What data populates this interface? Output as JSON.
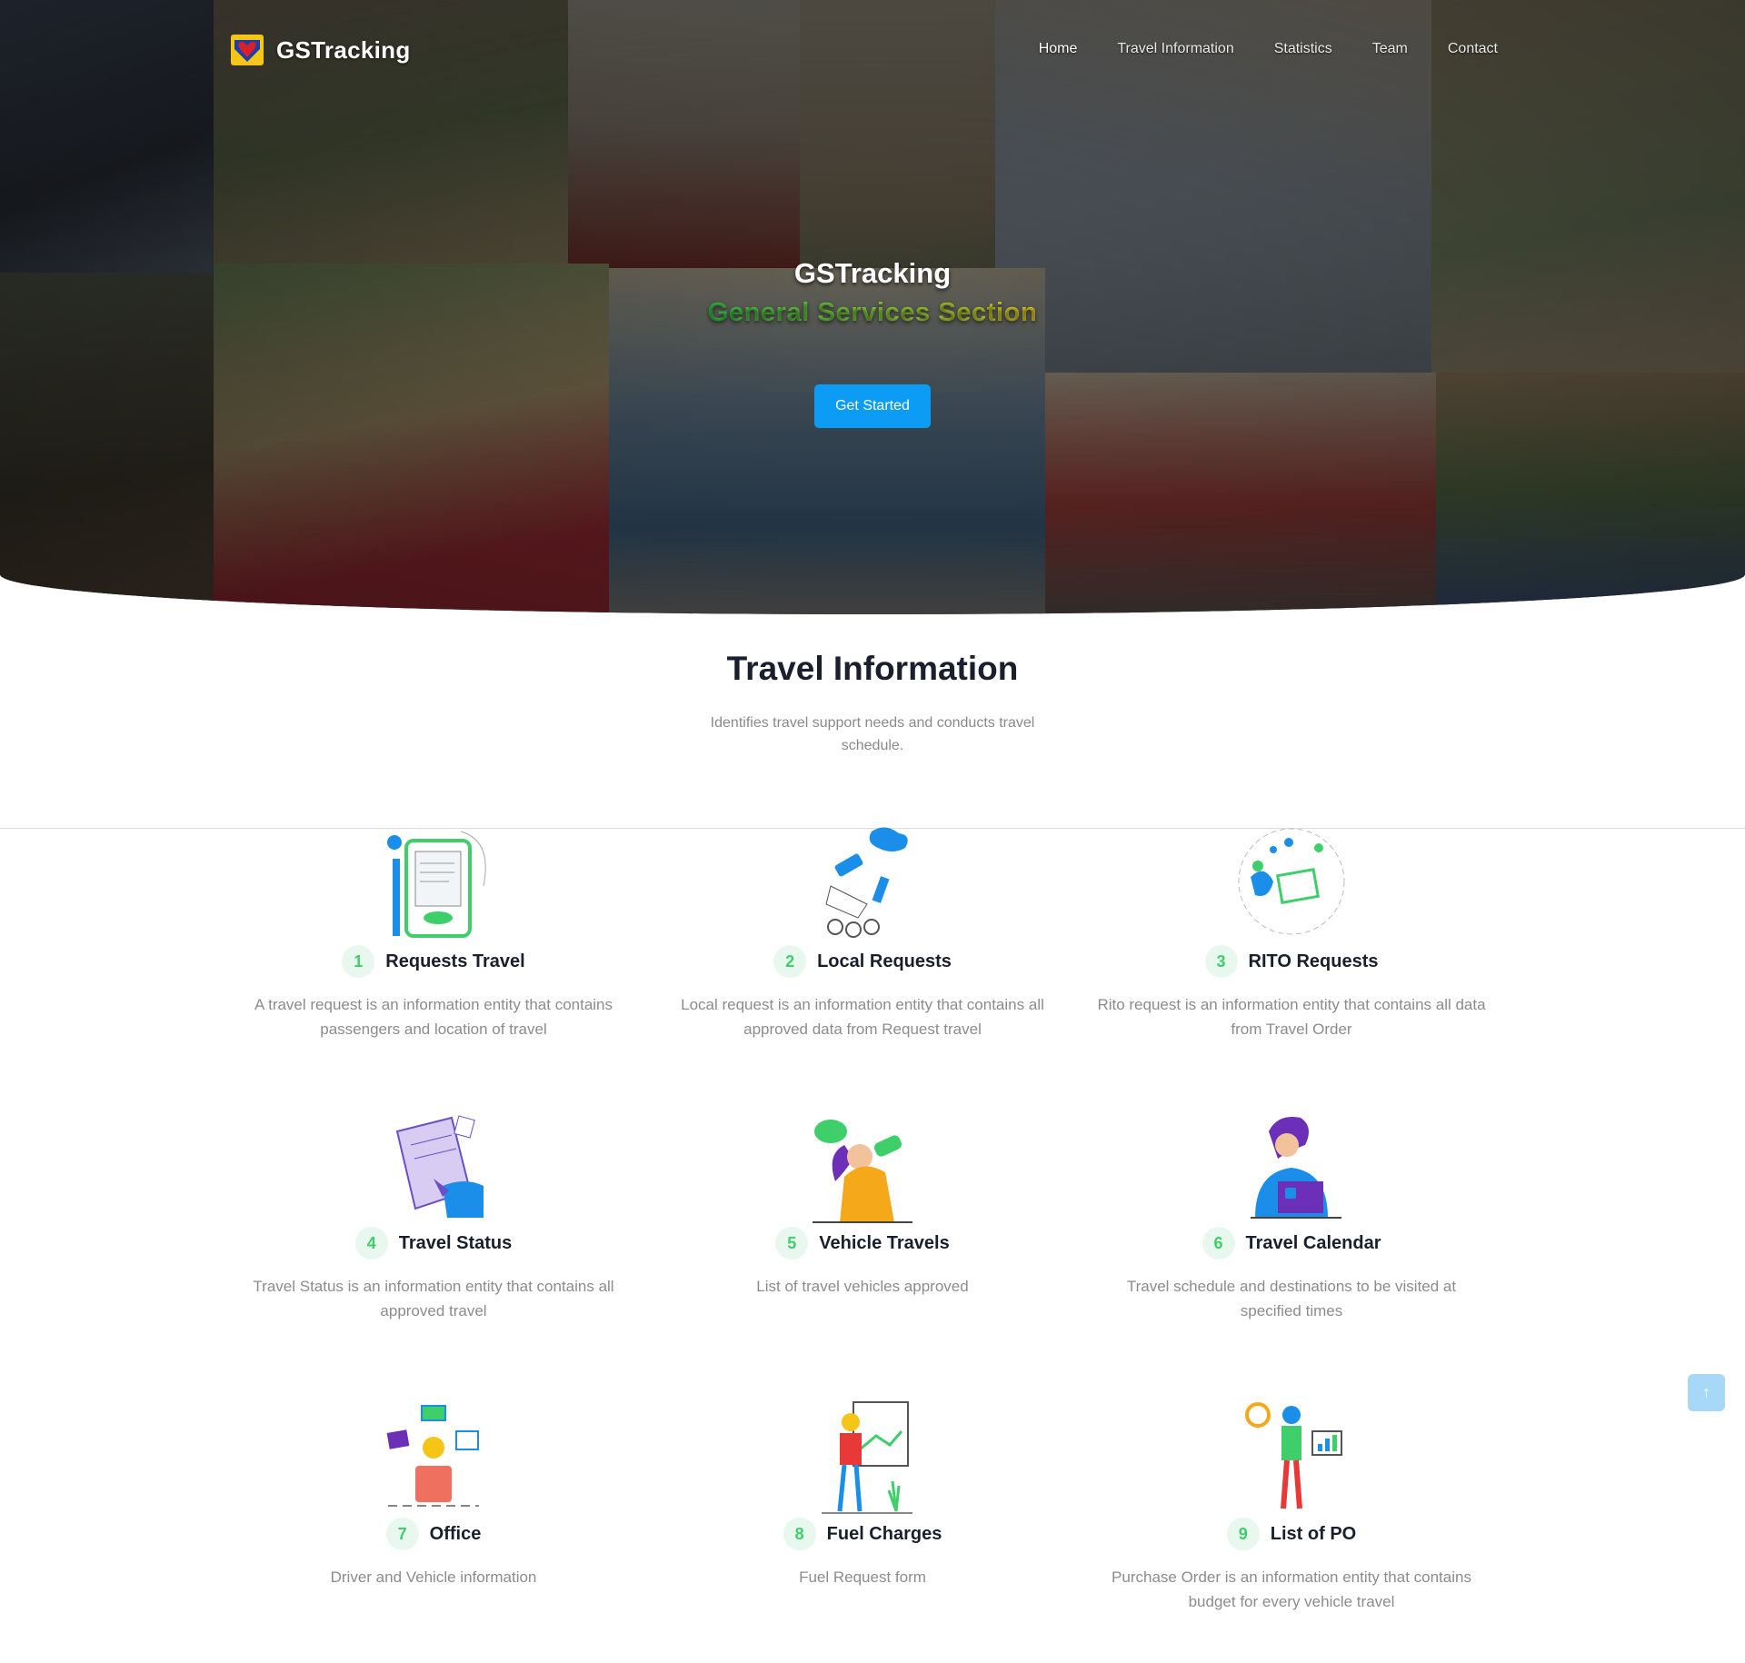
{
  "brand": {
    "name": "GSTracking",
    "logo_icon": "dswd-heart-logo-icon"
  },
  "nav": {
    "items": [
      {
        "label": "Home",
        "active": true
      },
      {
        "label": "Travel Information",
        "active": false
      },
      {
        "label": "Statistics",
        "active": false
      },
      {
        "label": "Team",
        "active": false
      },
      {
        "label": "Contact",
        "active": false
      }
    ]
  },
  "hero": {
    "title": "GSTracking",
    "subtitle": "General Services Section",
    "cta_label": "Get Started"
  },
  "section": {
    "title": "Travel Information",
    "description": "Identifies travel support needs and conducts travel schedule."
  },
  "cards": [
    {
      "number": "1",
      "title": "Requests Travel",
      "description": "A travel request is an information entity that contains passengers and location of travel",
      "icon": "travel-request-illustration-icon"
    },
    {
      "number": "2",
      "title": "Local Requests",
      "description": "Local request is an information entity that contains all approved data from Request travel",
      "icon": "local-request-illustration-icon"
    },
    {
      "number": "3",
      "title": "RITO Requests",
      "description": "Rito request is an information entity that contains all data from Travel Order",
      "icon": "rito-request-illustration-icon"
    },
    {
      "number": "4",
      "title": "Travel Status",
      "description": "Travel Status is an information entity that contains all approved travel",
      "icon": "travel-status-illustration-icon"
    },
    {
      "number": "5",
      "title": "Vehicle Travels",
      "description": "List of travel vehicles approved",
      "icon": "vehicle-travels-illustration-icon"
    },
    {
      "number": "6",
      "title": "Travel Calendar",
      "description": "Travel schedule and destinations to be visited at specified times",
      "icon": "travel-calendar-illustration-icon"
    },
    {
      "number": "7",
      "title": "Office",
      "description": "Driver and Vehicle information",
      "icon": "office-illustration-icon"
    },
    {
      "number": "8",
      "title": "Fuel Charges",
      "description": "Fuel Request form",
      "icon": "fuel-charges-illustration-icon"
    },
    {
      "number": "9",
      "title": "List of PO",
      "description": "Purchase Order is an information entity that contains budget for every vehicle travel",
      "icon": "list-of-po-illustration-icon"
    }
  ],
  "colors": {
    "accent": "#0d9cf5",
    "number_badge_bg": "#e9f8ee",
    "number_badge_text": "#3ecf6a",
    "heading": "#1a1f2e",
    "muted": "#8c8c8c"
  },
  "back_to_top": {
    "icon": "arrow-up-icon",
    "glyph": "↑"
  }
}
